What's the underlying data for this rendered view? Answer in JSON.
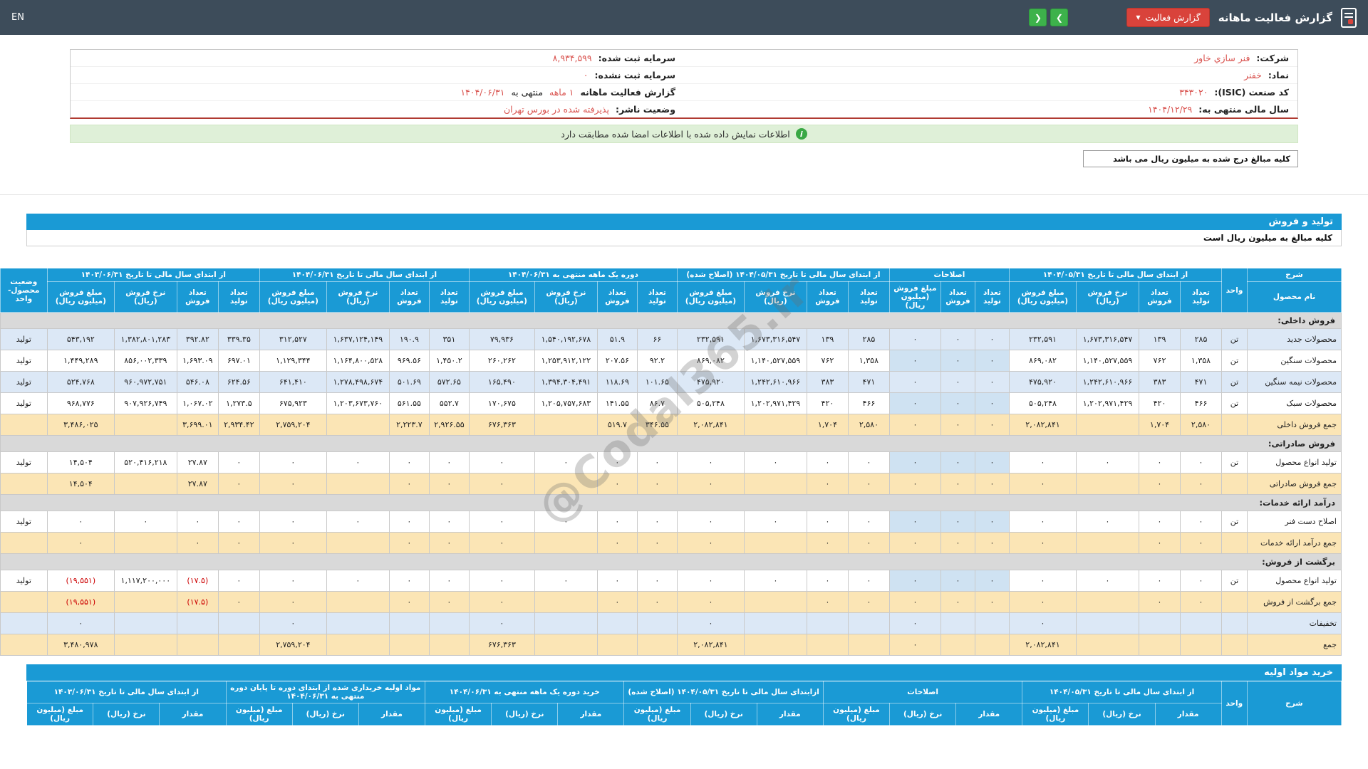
{
  "navbar": {
    "title": "گزارش فعالیت ماهانه",
    "report_button": "گزارش فعالیت",
    "next_arrow": "❯",
    "prev_arrow": "❮",
    "lang": "EN"
  },
  "company": {
    "right": [
      {
        "label": "شرکت:",
        "value": "فنر سازي خاور"
      },
      {
        "label": "نماد:",
        "value": "خفنر"
      },
      {
        "label": "کد صنعت (ISIC):",
        "value": "۳۴۳۰۲۰"
      },
      {
        "label": "سال مالی منتهی به:",
        "value": "۱۴۰۴/۱۲/۲۹"
      }
    ],
    "left": [
      {
        "label": "سرمایه ثبت شده:",
        "value": "۸,۹۳۴,۵۹۹"
      },
      {
        "label": "سرمایه ثبت نشده:",
        "value": "۰"
      },
      {
        "label": "گزارش فعالیت ماهانه",
        "value": "۱ ماهه",
        "mid": "منتهی به",
        "value2": "۱۴۰۴/۰۶/۳۱"
      },
      {
        "label": "وضعیت ناشر:",
        "value": "پذیرفته شده در بورس تهران"
      }
    ]
  },
  "notices": {
    "signed": "اطلاعات نمایش داده شده با اطلاعات امضا شده مطابقت دارد",
    "note": "کلیه مبالغ درج شده به میلیون ریال می باشد"
  },
  "watermark": "@Codal365.ir",
  "colors": {
    "navbar": "#3d4c5a",
    "accent_blue": "#1a9ad5",
    "green_button": "#3db24b",
    "red_button": "#d9433b",
    "success_bg": "#dff0d8",
    "value_red": "#d9534f",
    "sum_row": "#fbe5b5",
    "zebra_blue": "#dce8f6",
    "adjust_band": "#cfe2f2",
    "section_gray": "#d9d9d9",
    "negative": "#cc0000"
  },
  "sales_table": {
    "title": "تولید و فروش",
    "note": "کلیه مبالغ به میلیون ریال است",
    "col_desc": "شرح",
    "col_name": "نام محصول",
    "col_unit": "واحد",
    "col_status": "وضعیت محصول-واحد",
    "groups": [
      {
        "label": "از ابتدای سال مالی تا تاریخ ۱۴۰۴/۰۵/۳۱",
        "cols": [
          "تعداد تولید",
          "تعداد فروش",
          "نرخ فروش (ریال)",
          "مبلغ فروش (میلیون ریال)"
        ]
      },
      {
        "label": "اصلاحات",
        "cols": [
          "تعداد تولید",
          "تعداد فروش",
          "مبلغ فروش (میلیون ریال)"
        ]
      },
      {
        "label": "از ابتدای سال مالی تا تاریخ ۱۴۰۴/۰۵/۳۱ (اصلاح شده)",
        "cols": [
          "تعداد تولید",
          "تعداد فروش",
          "نرخ فروش (ریال)",
          "مبلغ فروش (میلیون ریال)"
        ]
      },
      {
        "label": "دوره یک ماهه منتهی به ۱۴۰۴/۰۶/۳۱",
        "cols": [
          "تعداد تولید",
          "تعداد فروش",
          "نرخ فروش (ریال)",
          "مبلغ فروش (میلیون ریال)"
        ]
      },
      {
        "label": "از ابتدای سال مالی تا تاریخ ۱۴۰۴/۰۶/۳۱",
        "cols": [
          "تعداد تولید",
          "تعداد فروش",
          "نرخ فروش (ریال)",
          "مبلغ فروش (میلیون ریال)"
        ]
      },
      {
        "label": "از ابتدای سال مالی تا تاریخ ۱۴۰۳/۰۶/۳۱",
        "cols": [
          "تعداد تولید",
          "تعداد فروش",
          "نرخ فروش (ریال)",
          "مبلغ فروش (میلیون ریال)"
        ]
      }
    ],
    "rows": [
      {
        "type": "section",
        "name": "فروش داخلی:"
      },
      {
        "type": "item",
        "cls": "blue",
        "name": "محصولات جدید",
        "unit": "تن",
        "status": "تولید",
        "cells": [
          "۲۸۵",
          "۱۳۹",
          "۱,۶۷۳,۳۱۶,۵۴۷",
          "۲۳۲,۵۹۱",
          "۰",
          "۰",
          "۰",
          "۲۸۵",
          "۱۳۹",
          "۱,۶۷۳,۳۱۶,۵۴۷",
          "۲۳۲,۵۹۱",
          "۶۶",
          "۵۱.۹",
          "۱,۵۴۰,۱۹۲,۶۷۸",
          "۷۹,۹۳۶",
          "۳۵۱",
          "۱۹۰.۹",
          "۱,۶۳۷,۱۲۴,۱۴۹",
          "۳۱۲,۵۲۷",
          "۳۳۹.۳۵",
          "۳۹۲.۸۲",
          "۱,۳۸۲,۸۰۱,۲۸۳",
          "۵۴۳,۱۹۲"
        ]
      },
      {
        "type": "item",
        "cls": "white",
        "name": "محصولات سنگین",
        "unit": "تن",
        "status": "تولید",
        "cells": [
          "۱,۳۵۸",
          "۷۶۲",
          "۱,۱۴۰,۵۲۷,۵۵۹",
          "۸۶۹,۰۸۲",
          "۰",
          "۰",
          "۰",
          "۱,۳۵۸",
          "۷۶۲",
          "۱,۱۴۰,۵۲۷,۵۵۹",
          "۸۶۹,۰۸۲",
          "۹۲.۲",
          "۲۰۷.۵۶",
          "۱,۲۵۳,۹۱۲,۱۲۲",
          "۲۶۰,۲۶۲",
          "۱,۴۵۰.۲",
          "۹۶۹.۵۶",
          "۱,۱۶۴,۸۰۰,۵۲۸",
          "۱,۱۲۹,۳۴۴",
          "۶۹۷.۰۱",
          "۱,۶۹۳.۰۹",
          "۸۵۶,۰۰۲,۳۳۹",
          "۱,۴۴۹,۲۸۹"
        ]
      },
      {
        "type": "item",
        "cls": "blue",
        "name": "محصولات نیمه سنگین",
        "unit": "تن",
        "status": "تولید",
        "cells": [
          "۴۷۱",
          "۳۸۳",
          "۱,۲۴۲,۶۱۰,۹۶۶",
          "۴۷۵,۹۲۰",
          "۰",
          "۰",
          "۰",
          "۴۷۱",
          "۳۸۳",
          "۱,۲۴۲,۶۱۰,۹۶۶",
          "۴۷۵,۹۲۰",
          "۱۰۱.۶۵",
          "۱۱۸.۶۹",
          "۱,۳۹۴,۳۰۴,۴۹۱",
          "۱۶۵,۴۹۰",
          "۵۷۲.۶۵",
          "۵۰۱.۶۹",
          "۱,۲۷۸,۴۹۸,۶۷۴",
          "۶۴۱,۴۱۰",
          "۶۲۴.۵۶",
          "۵۴۶.۰۸",
          "۹۶۰,۹۷۲,۷۵۱",
          "۵۲۴,۷۶۸"
        ]
      },
      {
        "type": "item",
        "cls": "white",
        "name": "محصولات سبک",
        "unit": "تن",
        "status": "تولید",
        "cells": [
          "۴۶۶",
          "۴۲۰",
          "۱,۲۰۲,۹۷۱,۴۲۹",
          "۵۰۵,۲۴۸",
          "۰",
          "۰",
          "۰",
          "۴۶۶",
          "۴۲۰",
          "۱,۲۰۲,۹۷۱,۴۲۹",
          "۵۰۵,۲۴۸",
          "۸۶.۷",
          "۱۴۱.۵۵",
          "۱,۲۰۵,۷۵۷,۶۸۳",
          "۱۷۰,۶۷۵",
          "۵۵۲.۷",
          "۵۶۱.۵۵",
          "۱,۲۰۳,۶۷۳,۷۶۰",
          "۶۷۵,۹۲۳",
          "۱,۲۷۳.۵",
          "۱,۰۶۷.۰۲",
          "۹۰۷,۹۲۶,۷۴۹",
          "۹۶۸,۷۷۶"
        ]
      },
      {
        "type": "item",
        "cls": "sum",
        "name": "جمع فروش داخلی",
        "unit": "",
        "status": "",
        "cells": [
          "۲,۵۸۰",
          "۱,۷۰۴",
          "",
          "۲,۰۸۲,۸۴۱",
          "۰",
          "۰",
          "۰",
          "۲,۵۸۰",
          "۱,۷۰۴",
          "",
          "۲,۰۸۲,۸۴۱",
          "۳۴۶.۵۵",
          "۵۱۹.۷",
          "",
          "۶۷۶,۳۶۳",
          "۲,۹۲۶.۵۵",
          "۲,۲۲۳.۷",
          "",
          "۲,۷۵۹,۲۰۴",
          "۲,۹۳۴.۴۲",
          "۳,۶۹۹.۰۱",
          "",
          "۳,۴۸۶,۰۲۵"
        ]
      },
      {
        "type": "section",
        "name": "فروش صادراتی:"
      },
      {
        "type": "item",
        "cls": "white",
        "name": "تولید انواع محصول",
        "unit": "تن",
        "status": "تولید",
        "cells": [
          "۰",
          "۰",
          "۰",
          "۰",
          "۰",
          "۰",
          "۰",
          "۰",
          "۰",
          "۰",
          "۰",
          "۰",
          "۰",
          "۰",
          "۰",
          "۰",
          "۰",
          "۰",
          "۰",
          "۰",
          "۲۷.۸۷",
          "۵۲۰,۴۱۶,۲۱۸",
          "۱۴,۵۰۴"
        ]
      },
      {
        "type": "item",
        "cls": "sum",
        "name": "جمع فروش صادراتی",
        "unit": "",
        "status": "",
        "cells": [
          "۰",
          "۰",
          "",
          "۰",
          "۰",
          "۰",
          "۰",
          "۰",
          "۰",
          "",
          "۰",
          "۰",
          "۰",
          "",
          "۰",
          "۰",
          "۰",
          "",
          "۰",
          "۰",
          "۲۷.۸۷",
          "",
          "۱۴,۵۰۴"
        ]
      },
      {
        "type": "section",
        "name": "درآمد ارائه خدمات:"
      },
      {
        "type": "item",
        "cls": "white",
        "name": "اصلاح دست فنر",
        "unit": "تن",
        "status": "تولید",
        "cells": [
          "۰",
          "۰",
          "۰",
          "۰",
          "۰",
          "۰",
          "۰",
          "۰",
          "۰",
          "۰",
          "۰",
          "۰",
          "۰",
          "۰",
          "۰",
          "۰",
          "۰",
          "۰",
          "۰",
          "۰",
          "۰",
          "۰",
          "۰"
        ]
      },
      {
        "type": "item",
        "cls": "sum",
        "name": "جمع درآمد ارائه خدمات",
        "unit": "",
        "status": "",
        "cells": [
          "۰",
          "۰",
          "",
          "۰",
          "۰",
          "۰",
          "۰",
          "۰",
          "۰",
          "",
          "۰",
          "۰",
          "۰",
          "",
          "۰",
          "۰",
          "۰",
          "",
          "۰",
          "۰",
          "۰",
          "",
          "۰"
        ]
      },
      {
        "type": "section",
        "name": "برگشت از فروش:"
      },
      {
        "type": "item",
        "cls": "white",
        "name": "تولید انواع محصول",
        "unit": "تن",
        "status": "تولید",
        "cells": [
          "۰",
          "۰",
          "۰",
          "۰",
          "۰",
          "۰",
          "۰",
          "۰",
          "۰",
          "۰",
          "۰",
          "۰",
          "۰",
          "۰",
          "۰",
          "۰",
          "۰",
          "۰",
          "۰",
          "۰",
          "(۱۷.۵)",
          "۱,۱۱۷,۲۰۰,۰۰۰",
          "(۱۹,۵۵۱)"
        ]
      },
      {
        "type": "item",
        "cls": "sum",
        "name": "جمع برگشت از فروش",
        "unit": "",
        "status": "",
        "cells": [
          "۰",
          "۰",
          "",
          "۰",
          "۰",
          "۰",
          "۰",
          "۰",
          "۰",
          "",
          "۰",
          "۰",
          "۰",
          "",
          "۰",
          "۰",
          "۰",
          "",
          "۰",
          "۰",
          "(۱۷.۵)",
          "",
          "(۱۹,۵۵۱)"
        ]
      },
      {
        "type": "item",
        "cls": "blue",
        "name": "تخفیفات",
        "unit": "",
        "status": "",
        "cells": [
          "",
          "",
          "",
          "۰",
          "",
          "",
          "۰",
          "",
          "",
          "",
          "۰",
          "",
          "",
          "",
          "۰",
          "",
          "",
          "",
          "۰",
          "",
          "",
          "",
          "۰"
        ]
      },
      {
        "type": "item",
        "cls": "sum",
        "name": "جمع",
        "unit": "",
        "status": "",
        "cells": [
          "",
          "",
          "",
          "۲,۰۸۲,۸۴۱",
          "",
          "",
          "۰",
          "",
          "",
          "",
          "۲,۰۸۲,۸۴۱",
          "",
          "",
          "",
          "۶۷۶,۳۶۳",
          "",
          "",
          "",
          "۲,۷۵۹,۲۰۴",
          "",
          "",
          "",
          "۳,۴۸۰,۹۷۸"
        ]
      }
    ]
  },
  "purchase_table": {
    "title": "خرید مواد اولیه",
    "col_desc": "شرح",
    "col_unit": "واحد",
    "groups": [
      {
        "label": "از ابتدای سال مالی تا تاریخ ۱۴۰۴/۰۵/۳۱",
        "cols": [
          "مقدار",
          "نرخ (ریال)",
          "مبلغ (میلیون ریال)"
        ]
      },
      {
        "label": "اصلاحات",
        "cols": [
          "مقدار",
          "نرخ (ریال)",
          "مبلغ (میلیون ریال)"
        ]
      },
      {
        "label": "ازابتدای سال مالی تا تاریخ ۱۴۰۴/۰۵/۳۱ (اصلاح شده)",
        "cols": [
          "مقدار",
          "نرخ (ریال)",
          "مبلغ (میلیون ریال)"
        ]
      },
      {
        "label": "خرید دوره یک ماهه منتهی به ۱۴۰۴/۰۶/۳۱",
        "cols": [
          "مقدار",
          "نرخ (ریال)",
          "مبلغ (میلیون ریال)"
        ]
      },
      {
        "label": "مواد اولیه خریداری شده از ابتدای دوره تا پایان دوره منتهی به ۱۴۰۴/۰۶/۳۱",
        "cols": [
          "مقدار",
          "نرخ (ریال)",
          "مبلغ (میلیون ریال)"
        ]
      },
      {
        "label": "از ابتدای سال مالی تا تاریخ ۱۴۰۳/۰۶/۳۱",
        "cols": [
          "مقدار",
          "نرخ (ریال)",
          "مبلغ (میلیون ریال)"
        ]
      }
    ],
    "rows": []
  }
}
